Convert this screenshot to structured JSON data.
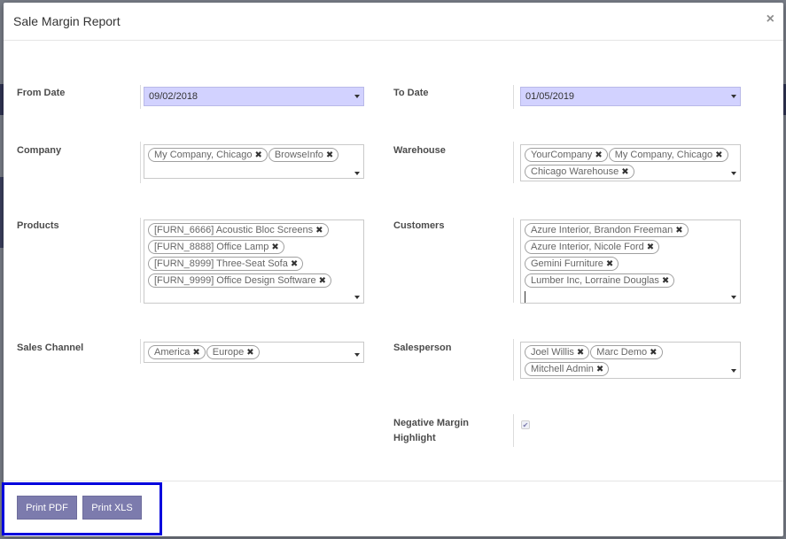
{
  "dialog": {
    "title": "Sale Margin Report",
    "close_symbol": "×"
  },
  "fields": {
    "from_date": {
      "label": "From Date",
      "value": "09/02/2018"
    },
    "to_date": {
      "label": "To Date",
      "value": "01/05/2019"
    },
    "company": {
      "label": "Company",
      "tags": [
        "My Company, Chicago",
        "BrowseInfo"
      ]
    },
    "warehouse": {
      "label": "Warehouse",
      "tags": [
        "YourCompany",
        "My Company, Chicago",
        "Chicago Warehouse"
      ]
    },
    "products": {
      "label": "Products",
      "tags": [
        "[FURN_6666] Acoustic Bloc Screens",
        "[FURN_8888] Office Lamp",
        "[FURN_8999] Three-Seat Sofa",
        "[FURN_9999] Office Design Software"
      ]
    },
    "customers": {
      "label": "Customers",
      "tags": [
        "Azure Interior, Brandon Freeman",
        "Azure Interior, Nicole Ford",
        "Gemini Furniture",
        "Lumber Inc, Lorraine Douglas"
      ]
    },
    "sales_channel": {
      "label": "Sales Channel",
      "tags": [
        "America",
        "Europe"
      ]
    },
    "salesperson": {
      "label": "Salesperson",
      "tags": [
        "Joel Willis",
        "Marc Demo",
        "Mitchell Admin"
      ]
    },
    "negative_margin": {
      "label_line1": "Negative Margin",
      "label_line2": "Highlight",
      "checked": true,
      "check_symbol": "✔"
    }
  },
  "tag_remove_symbol": "✖",
  "footer": {
    "print_pdf_label": "Print PDF",
    "print_xls_label": "Print XLS"
  },
  "colors": {
    "primary": "#7c7bad",
    "date_fill": "#d2d2ff",
    "highlight": "#0000dd"
  }
}
